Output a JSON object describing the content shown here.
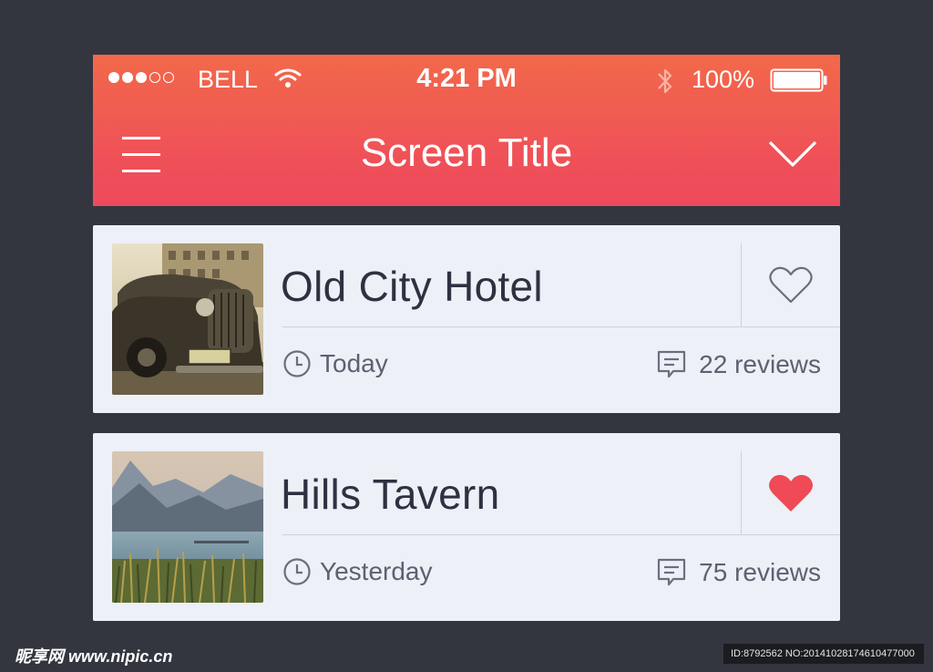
{
  "status_bar": {
    "carrier": "BELL",
    "time": "4:21 PM",
    "battery_percent": "100%",
    "signal_bars_filled": 3,
    "signal_bars_total": 5,
    "battery_level": 1.0
  },
  "header": {
    "title": "Screen Title",
    "menu_icon": "hamburger-menu-icon",
    "dropdown_icon": "chevron-down-icon"
  },
  "items": [
    {
      "title": "Old City Hotel",
      "time_label": "Today",
      "reviews_label": "22 reviews",
      "favorited": false,
      "image": "vintage-car-photo"
    },
    {
      "title": "Hills Tavern",
      "time_label": "Yesterday",
      "reviews_label": "75 reviews",
      "favorited": true,
      "image": "mountain-lake-photo"
    }
  ],
  "colors": {
    "header_top": "#f2694a",
    "header_bottom": "#ee4a5c",
    "background": "#33363f",
    "card": "#edf0f7",
    "heart_active": "#ef4a55",
    "text_dark": "#2e3140",
    "text_meta": "#5d6170"
  },
  "watermark": {
    "left": "昵享网 www.nipic.cn",
    "right": "ID:8792562 NO:20141028174610477000"
  }
}
